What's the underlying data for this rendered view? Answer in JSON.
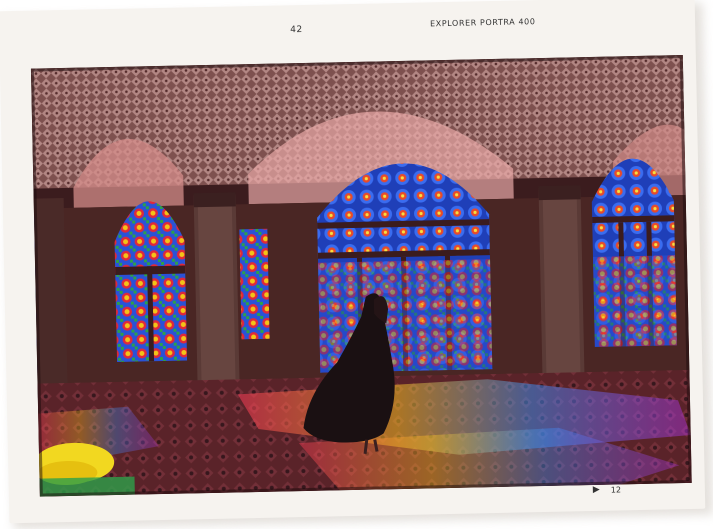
{
  "film_strip": {
    "frame_number": "42",
    "film_label": "EXPLORER PORTRA 400",
    "page_number": "12",
    "arrow_glyph": "▶"
  },
  "colors": {
    "paper": "#f6f3ef",
    "glass_red": "#e0283a",
    "glass_blue": "#2a52d8",
    "glass_yellow": "#f2c418",
    "glass_green": "#2da04a",
    "tile_pink": "#c89a96"
  }
}
